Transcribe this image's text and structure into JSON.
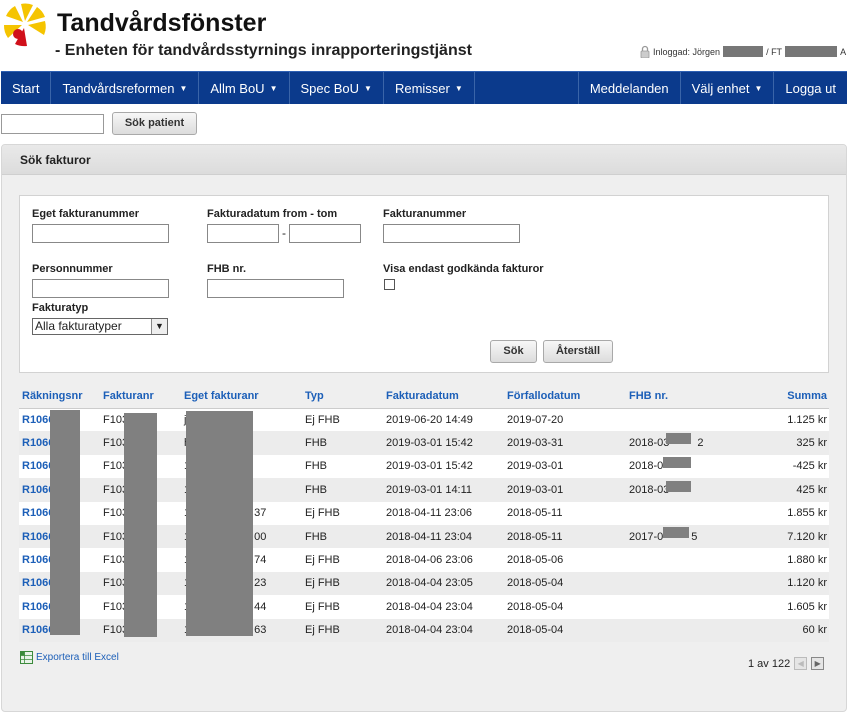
{
  "header": {
    "title": "Tandvårdsfönster",
    "subtitle": "- Enheten för tandvårdsstyrnings inrapporteringstjänst",
    "login_prefix": "Inloggad: Jörgen",
    "login_unit": "/ FT",
    "login_suffix": "A"
  },
  "nav": {
    "items": [
      {
        "label": "Start",
        "caret": false
      },
      {
        "label": "Tandvårdsreformen",
        "caret": true
      },
      {
        "label": "Allm BoU",
        "caret": true
      },
      {
        "label": "Spec BoU",
        "caret": true
      },
      {
        "label": "Remisser",
        "caret": true
      }
    ],
    "right_items": [
      {
        "label": "Meddelanden",
        "caret": false
      },
      {
        "label": "Välj enhet",
        "caret": true
      },
      {
        "label": "Logga ut",
        "caret": false
      }
    ],
    "caret_glyph": "▼"
  },
  "patient_search": {
    "value": "",
    "button": "Sök patient"
  },
  "panel": {
    "title": "Sök fakturor"
  },
  "form": {
    "own_invoice_label": "Eget fakturanummer",
    "date_label": "Fakturadatum from - tom",
    "invoice_label": "Fakturanummer",
    "pnr_label": "Personnummer",
    "fhb_label": "FHB nr.",
    "approved_label": "Visa endast godkända fakturor",
    "approved_checked": false,
    "type_label": "Fakturatyp",
    "type_value": "Alla fakturatyper",
    "date_sep": "-",
    "search_button": "Sök",
    "reset_button": "Återställ"
  },
  "table": {
    "headers": [
      "Räkningsnr",
      "Fakturanr",
      "Eget fakturanr",
      "Typ",
      "Fakturadatum",
      "Förfallodatum",
      "FHB nr.",
      "Summa"
    ],
    "rows": [
      {
        "rnr": "R1066",
        "fnr": "F1030000",
        "egen": "j",
        "typ": "Ej FHB",
        "fdat": "2019-06-20 14:49",
        "ffd": "2019-07-20",
        "fhb": "",
        "summa": "1.125 kr"
      },
      {
        "rnr": "R1066",
        "fnr": "F103",
        "egen": "h",
        "typ": "FHB",
        "fdat": "2019-03-01 15:42",
        "ffd": "2019-03-31",
        "fhb": "2018-03",
        "fhb_tail": "2",
        "summa": "325 kr"
      },
      {
        "rnr": "R1066",
        "fnr": "F103",
        "egen": "1",
        "typ": "FHB",
        "fdat": "2019-03-01 15:42",
        "ffd": "2019-03-01",
        "fhb": "2018-0",
        "fhb_tail": "",
        "summa": "-425 kr"
      },
      {
        "rnr": "R1066",
        "fnr": "F103",
        "egen": "1",
        "typ": "FHB",
        "fdat": "2019-03-01 14:11",
        "ffd": "2019-03-01",
        "fhb": "2018-03",
        "fhb_tail": "",
        "summa": "425 kr"
      },
      {
        "rnr": "R1066",
        "fnr": "F103",
        "egen": "1",
        "egen_tail": "37",
        "typ": "Ej FHB",
        "fdat": "2018-04-11 23:06",
        "ffd": "2018-05-11",
        "fhb": "",
        "summa": "1.855 kr"
      },
      {
        "rnr": "R1066",
        "fnr": "F103",
        "egen": "1",
        "egen_tail": "00",
        "typ": "FHB",
        "fdat": "2018-04-11 23:04",
        "ffd": "2018-05-11",
        "fhb": "2017-0",
        "fhb_tail": "5",
        "summa": "7.120 kr"
      },
      {
        "rnr": "R1066",
        "fnr": "F103",
        "egen": "1",
        "egen_tail": "74",
        "typ": "Ej FHB",
        "fdat": "2018-04-06 23:06",
        "ffd": "2018-05-06",
        "fhb": "",
        "summa": "1.880 kr"
      },
      {
        "rnr": "R1066",
        "fnr": "F103",
        "egen": "1",
        "egen_tail": "23",
        "typ": "Ej FHB",
        "fdat": "2018-04-04 23:05",
        "ffd": "2018-05-04",
        "fhb": "",
        "summa": "1.120 kr"
      },
      {
        "rnr": "R1066",
        "fnr": "F103",
        "egen": "1",
        "egen_tail": "44",
        "typ": "Ej FHB",
        "fdat": "2018-04-04 23:04",
        "ffd": "2018-05-04",
        "fhb": "",
        "summa": "1.605 kr"
      },
      {
        "rnr": "R1066",
        "fnr": "F103",
        "egen": "1",
        "egen_tail": "63",
        "typ": "Ej FHB",
        "fdat": "2018-04-04 23:04",
        "ffd": "2018-05-04",
        "fhb": "",
        "summa": "60 kr"
      }
    ]
  },
  "footer": {
    "export_label": "Exportera till Excel",
    "pager_text": "1 av 122",
    "prev_glyph": "◀",
    "next_glyph": "▶"
  },
  "colors": {
    "nav": "#0b3a8c",
    "link": "#1c5fb8",
    "logo_yellow": "#f5c400",
    "logo_red": "#d0101a"
  }
}
